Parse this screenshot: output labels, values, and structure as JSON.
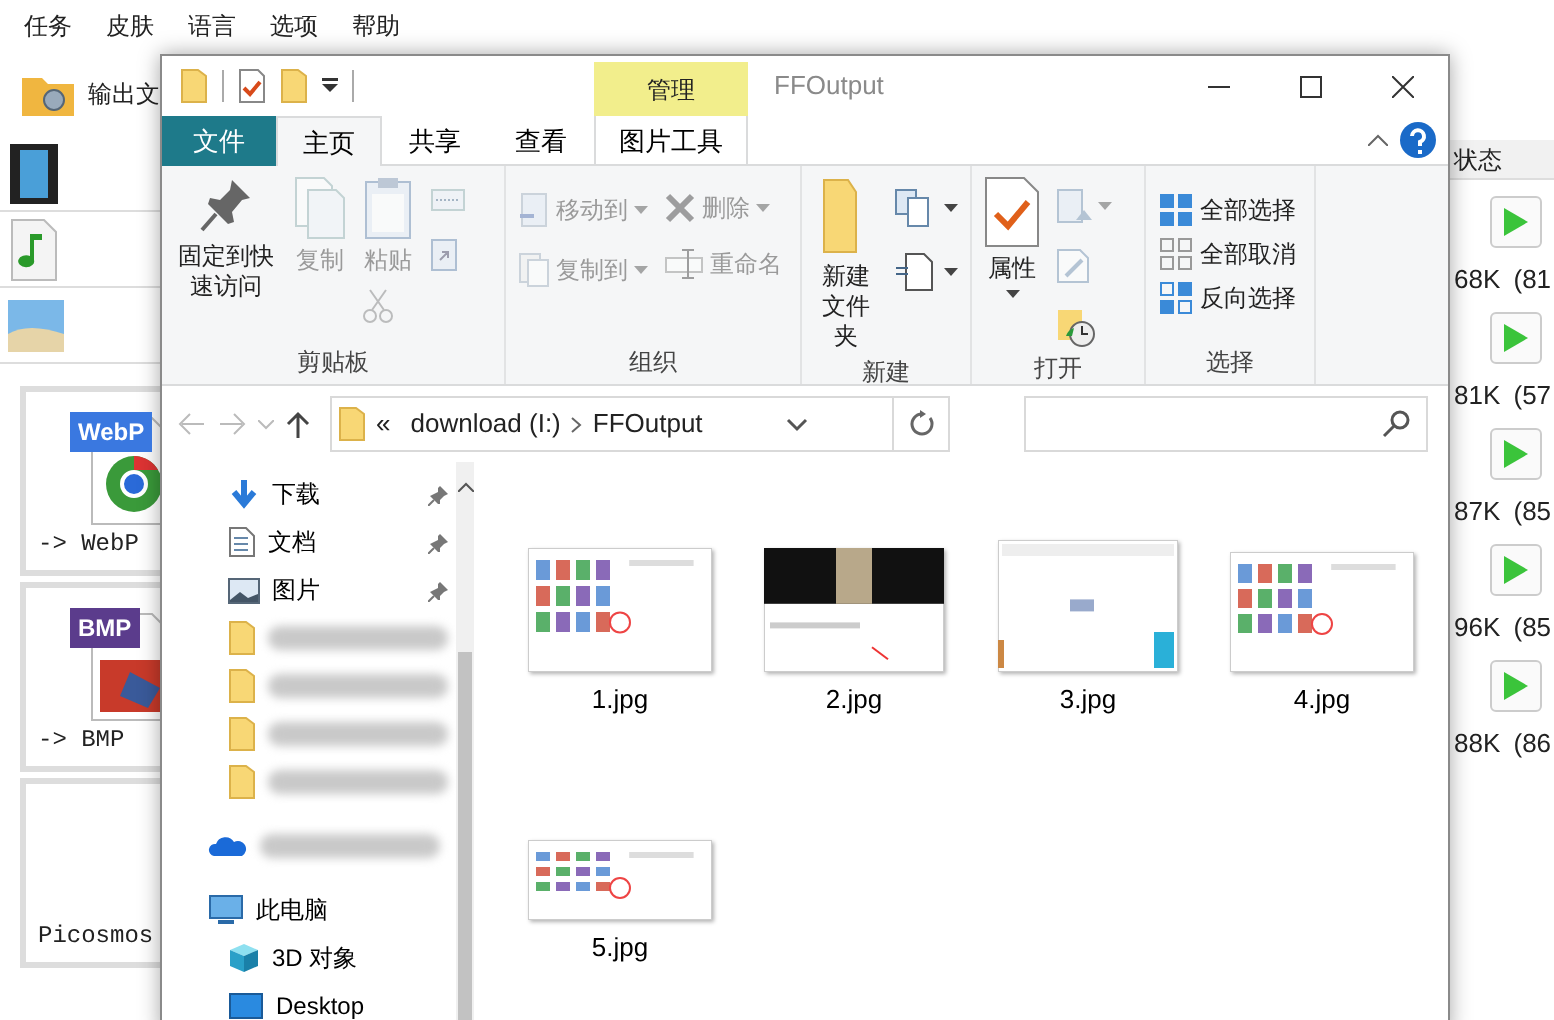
{
  "app": {
    "menu": [
      "任务",
      "皮肤",
      "语言",
      "选项",
      "帮助"
    ],
    "toolbar_button": "输出文",
    "tiles": [
      {
        "badge": "WebP",
        "color": "#3a78e0",
        "label": "-> WebP"
      },
      {
        "badge": "BMP",
        "color": "#5b3c8c",
        "label": "-> BMP"
      },
      {
        "label": "Picosmos"
      }
    ],
    "status_header": "状态",
    "rows": [
      {
        "size": "68K (81"
      },
      {
        "size": "81K (57"
      },
      {
        "size": "87K (85"
      },
      {
        "size": "96K (85"
      },
      {
        "size": "88K (86"
      }
    ]
  },
  "explorer": {
    "title": "FFOutput",
    "context_group": "管理",
    "tabs": [
      {
        "label": "文件",
        "kind": "file",
        "selected": false
      },
      {
        "label": "主页",
        "kind": "plain",
        "selected": true
      },
      {
        "label": "共享",
        "kind": "plain",
        "selected": false
      },
      {
        "label": "查看",
        "kind": "plain",
        "selected": false
      },
      {
        "label": "图片工具",
        "kind": "context",
        "selected": false
      }
    ],
    "ribbon": [
      {
        "label": "剪贴板",
        "columns": [
          [
            {
              "kind": "large",
              "label": "固定到快速访问",
              "disabled": false
            }
          ],
          [
            {
              "kind": "large",
              "label": "复制",
              "disabled": true
            }
          ],
          [
            {
              "kind": "large",
              "label": "粘贴",
              "disabled": true
            },
            {
              "kind": "icon",
              "disabled": true
            }
          ],
          [
            {
              "kind": "icon",
              "disabled": true
            },
            {
              "kind": "icon",
              "disabled": true
            }
          ]
        ]
      },
      {
        "label": "组织",
        "columns": [
          [
            {
              "kind": "small",
              "label": "移动到",
              "dropdown": true,
              "disabled": true
            },
            {
              "kind": "small",
              "label": "复制到",
              "dropdown": true,
              "disabled": true
            }
          ],
          [
            {
              "kind": "small",
              "label": "删除",
              "dropdown": true,
              "disabled": true
            },
            {
              "kind": "small",
              "label": "重命名",
              "disabled": true
            }
          ]
        ]
      },
      {
        "label": "新建",
        "columns": [
          [
            {
              "kind": "large",
              "label": "新建文件夹",
              "disabled": false
            }
          ],
          [
            {
              "kind": "icon",
              "dropdown": true,
              "disabled": false
            },
            {
              "kind": "icon",
              "dropdown": true,
              "disabled": false
            }
          ]
        ]
      },
      {
        "label": "打开",
        "columns": [
          [
            {
              "kind": "large",
              "label": "属性",
              "dropdown": true,
              "disabled": false
            }
          ],
          [
            {
              "kind": "icon",
              "dropdown": true,
              "disabled": true
            },
            {
              "kind": "icon",
              "disabled": true
            },
            {
              "kind": "icon",
              "disabled": false
            }
          ]
        ]
      },
      {
        "label": "选择",
        "columns": [
          [
            {
              "kind": "small",
              "label": "全部选择",
              "disabled": false
            },
            {
              "kind": "small",
              "label": "全部取消",
              "disabled": false
            },
            {
              "kind": "small",
              "label": "反向选择",
              "disabled": false
            }
          ]
        ]
      }
    ],
    "address": {
      "overflow": "«",
      "segments": [
        "download (I:)",
        "FFOutput"
      ]
    },
    "quick_access": [
      {
        "kind": "downloads",
        "label": "下载",
        "pinned": true
      },
      {
        "kind": "documents",
        "label": "文档",
        "pinned": true
      },
      {
        "kind": "pictures",
        "label": "图片",
        "pinned": true
      },
      {
        "kind": "folder",
        "redacted": true,
        "pinned": false
      },
      {
        "kind": "folder",
        "redacted": true,
        "pinned": false
      },
      {
        "kind": "folder",
        "redacted": true,
        "pinned": false
      },
      {
        "kind": "folder",
        "redacted": true,
        "pinned": false
      }
    ],
    "locations": [
      {
        "kind": "cloud",
        "redacted": true
      },
      {
        "kind": "computer",
        "label": "此电脑",
        "children": [
          {
            "kind": "objects3d",
            "label": "3D 对象"
          },
          {
            "kind": "desktop",
            "label": "Desktop"
          }
        ]
      }
    ],
    "files": [
      {
        "name": "1.jpg",
        "kind": "picture"
      },
      {
        "name": "2.jpg",
        "kind": "picture"
      },
      {
        "name": "3.jpg",
        "kind": "picture"
      },
      {
        "name": "4.jpg",
        "kind": "picture"
      },
      {
        "name": "5.jpg",
        "kind": "picture"
      }
    ]
  }
}
